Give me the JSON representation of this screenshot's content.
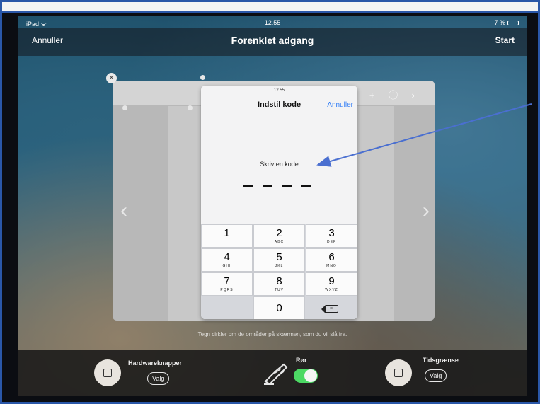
{
  "status_bar": {
    "device": "iPad ᯤ",
    "time": "12.55",
    "battery": "7 %"
  },
  "nav": {
    "cancel": "Annuller",
    "title": "Forenklet adgang",
    "start": "Start"
  },
  "passcode": {
    "status_time": "12.55",
    "title": "Indstil kode",
    "cancel": "Annuller",
    "prompt": "Skriv en kode",
    "keys": [
      {
        "n": "1",
        "l": ""
      },
      {
        "n": "2",
        "l": "ABC"
      },
      {
        "n": "3",
        "l": "DEF"
      },
      {
        "n": "4",
        "l": "GHI"
      },
      {
        "n": "5",
        "l": "JKL"
      },
      {
        "n": "6",
        "l": "MNO"
      },
      {
        "n": "7",
        "l": "PQRS"
      },
      {
        "n": "8",
        "l": "TUV"
      },
      {
        "n": "9",
        "l": "WXYZ"
      },
      {
        "n": "0",
        "l": ""
      }
    ]
  },
  "hint": "Tegn cirkler om de områder på skærmen, som du vil slå fra.",
  "toolbar": {
    "hardware_label": "Hardwareknapper",
    "hardware_btn": "Valg",
    "touch_label": "Rør",
    "time_label": "Tidsgrænse",
    "time_btn": "Valg"
  },
  "colors": {
    "accent": "#2f7cf6",
    "toggle_on": "#4cd964",
    "frame": "#2a57a8",
    "annotation_arrow": "#4a6fd0"
  }
}
